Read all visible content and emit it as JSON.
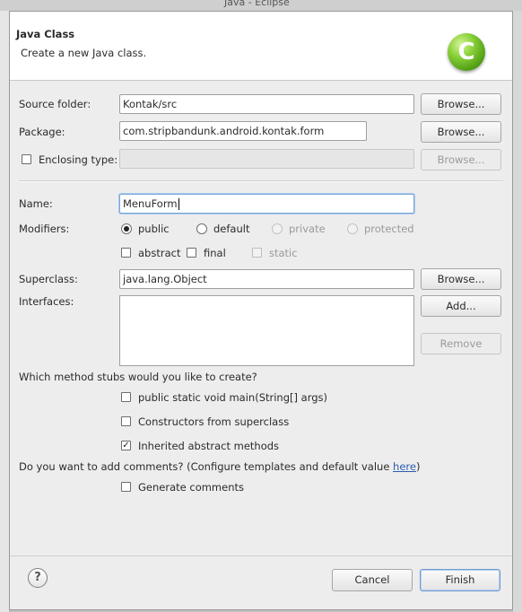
{
  "background": {
    "window_title": "Java - Eclipse"
  },
  "header": {
    "title": "Java Class",
    "description": "Create a new Java class.",
    "logo_letter": "C"
  },
  "form": {
    "source_folder": {
      "label": "Source folder:",
      "value": "Kontak/src",
      "browse": "Browse..."
    },
    "package": {
      "label": "Package:",
      "value": "com.stripbandunk.android.kontak.form",
      "browse": "Browse..."
    },
    "enclosing_type": {
      "label": "Enclosing type:",
      "value": "",
      "browse": "Browse...",
      "checked": false
    },
    "name": {
      "label": "Name:",
      "value": "MenuForm"
    },
    "modifiers": {
      "label": "Modifiers:",
      "public": "public",
      "default": "default",
      "private": "private",
      "protected": "protected",
      "abstract": "abstract",
      "final": "final",
      "static": "static",
      "selected": "public"
    },
    "superclass": {
      "label": "Superclass:",
      "value": "java.lang.Object",
      "browse": "Browse..."
    },
    "interfaces": {
      "label": "Interfaces:",
      "add": "Add...",
      "remove": "Remove"
    }
  },
  "stubs": {
    "question": "Which method stubs would you like to create?",
    "main": "public static void main(String[] args)",
    "constructors": "Constructors from superclass",
    "inherited": "Inherited abstract methods",
    "inherited_checked": true
  },
  "comments": {
    "question_prefix": "Do you want to add comments? (Configure templates and default value ",
    "link": "here",
    "question_suffix": ")",
    "generate": "Generate comments"
  },
  "footer": {
    "help": "?",
    "cancel": "Cancel",
    "finish": "Finish"
  }
}
